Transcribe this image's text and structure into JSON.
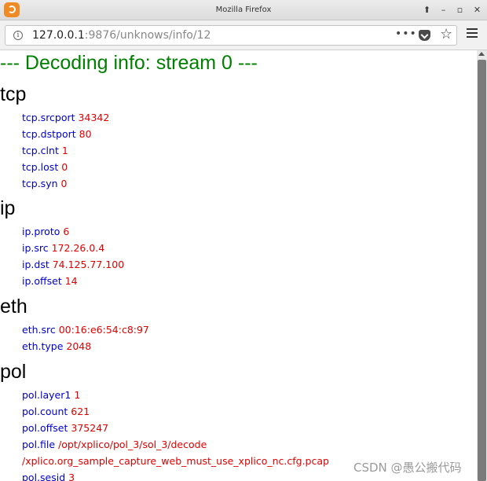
{
  "window": {
    "title": "Mozilla Firefox",
    "icon": "firefox-icon",
    "controls": [
      "up-arrow-icon",
      "minimize-icon",
      "maximize-icon",
      "close-icon"
    ]
  },
  "nav": {
    "url_host": "127.0.0.1",
    "url_rest": ":9876/unknows/info/12",
    "page_actions": "•••",
    "icons": [
      "info-icon",
      "pocket-icon",
      "bookmark-star-icon",
      "menu-icon"
    ]
  },
  "page": {
    "heading": "--- Decoding info: stream 0 ---",
    "sections": [
      {
        "title": "tcp",
        "rows": [
          {
            "key": "tcp.srcport",
            "value": "34342"
          },
          {
            "key": "tcp.dstport",
            "value": "80"
          },
          {
            "key": "tcp.clnt",
            "value": "1"
          },
          {
            "key": "tcp.lost",
            "value": "0"
          },
          {
            "key": "tcp.syn",
            "value": "0"
          }
        ]
      },
      {
        "title": "ip",
        "rows": [
          {
            "key": "ip.proto",
            "value": "6"
          },
          {
            "key": "ip.src",
            "value": "172.26.0.4"
          },
          {
            "key": "ip.dst",
            "value": "74.125.77.100"
          },
          {
            "key": "ip.offset",
            "value": "14"
          }
        ]
      },
      {
        "title": "eth",
        "rows": [
          {
            "key": "eth.src",
            "value": "00:16:e6:54:c8:97"
          },
          {
            "key": "eth.type",
            "value": "2048"
          }
        ]
      },
      {
        "title": "pol",
        "rows": [
          {
            "key": "pol.layer1",
            "value": "1"
          },
          {
            "key": "pol.count",
            "value": "621"
          },
          {
            "key": "pol.offset",
            "value": "375247"
          },
          {
            "key": "pol.file",
            "value": "/opt/xplico/pol_3/sol_3/decode"
          },
          {
            "key": "",
            "value": "/xplico.org_sample_capture_web_must_use_xplico_nc.cfg.pcap"
          },
          {
            "key": "pol.sesid",
            "value": "3"
          }
        ]
      }
    ]
  },
  "watermark": "CSDN @愚公搬代码",
  "colors": {
    "heading": "#008000",
    "key": "#0000cc",
    "value": "#e00000"
  }
}
